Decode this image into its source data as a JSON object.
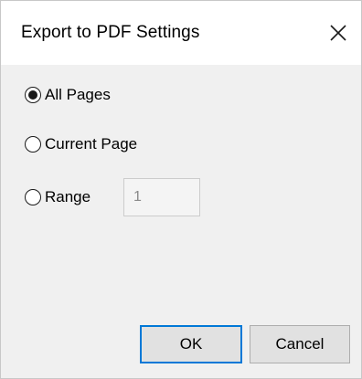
{
  "dialog": {
    "title": "Export to PDF Settings",
    "accent_color": "#0078d7",
    "close_icon": "close-icon"
  },
  "options": [
    {
      "label": "All Pages",
      "selected": true
    },
    {
      "label": "Current Page",
      "selected": false
    },
    {
      "label": "Range",
      "selected": false
    }
  ],
  "range": {
    "value": "1",
    "enabled": false
  },
  "buttons": {
    "ok_label": "OK",
    "cancel_label": "Cancel"
  }
}
